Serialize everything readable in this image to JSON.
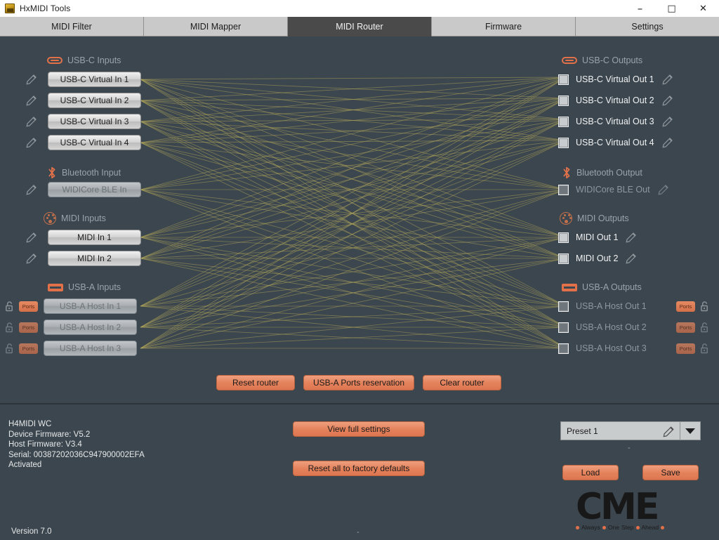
{
  "window": {
    "title": "HxMIDI Tools",
    "icon": "app-icon",
    "controls": {
      "minimize": "–",
      "maximize": "□",
      "close": "✕"
    }
  },
  "tabs": [
    {
      "label": "MIDI Filter",
      "active": false
    },
    {
      "label": "MIDI Mapper",
      "active": false
    },
    {
      "label": "MIDI Router",
      "active": true
    },
    {
      "label": "Firmware",
      "active": false
    },
    {
      "label": "Settings",
      "active": false
    }
  ],
  "router": {
    "input_sections": [
      {
        "title": "USB-C Inputs",
        "icon": "usb-c-icon",
        "ports": [
          {
            "label": "USB-C Virtual In 1",
            "muted": false,
            "edit": true
          },
          {
            "label": "USB-C Virtual In 2",
            "muted": false,
            "edit": true
          },
          {
            "label": "USB-C Virtual In 3",
            "muted": false,
            "edit": true
          },
          {
            "label": "USB-C Virtual In 4",
            "muted": false,
            "edit": true
          }
        ]
      },
      {
        "title": "Bluetooth Input",
        "icon": "bluetooth-icon",
        "ports": [
          {
            "label": "WIDICore BLE In",
            "muted": true,
            "edit": true
          }
        ]
      },
      {
        "title": "MIDI Inputs",
        "icon": "midi-din-icon",
        "ports": [
          {
            "label": "MIDI In 1",
            "muted": false,
            "edit": true
          },
          {
            "label": "MIDI In 2",
            "muted": false,
            "edit": true
          }
        ]
      },
      {
        "title": "USB-A Inputs",
        "icon": "usb-a-icon",
        "ports": [
          {
            "label": "USB-A Host In 1",
            "muted": true,
            "ports_label": "Ports",
            "lock": "unlocked"
          },
          {
            "label": "USB-A Host In 2",
            "muted": true,
            "ports_label": "Ports",
            "lock": "unlocked"
          },
          {
            "label": "USB-A Host In 3",
            "muted": true,
            "ports_label": "Ports",
            "lock": "unlocked"
          }
        ]
      }
    ],
    "output_sections": [
      {
        "title": "USB-C Outputs",
        "icon": "usb-c-icon",
        "ports": [
          {
            "label": "USB-C Virtual Out 1",
            "checked": false,
            "dim": false
          },
          {
            "label": "USB-C Virtual Out 2",
            "checked": false,
            "dim": false
          },
          {
            "label": "USB-C Virtual Out 3",
            "checked": false,
            "dim": false
          },
          {
            "label": "USB-C Virtual Out 4",
            "checked": false,
            "dim": false
          }
        ]
      },
      {
        "title": "Bluetooth Output",
        "icon": "bluetooth-icon",
        "ports": [
          {
            "label": "WIDICore BLE Out",
            "checked": false,
            "dim": true
          }
        ]
      },
      {
        "title": "MIDI Outputs",
        "icon": "midi-din-icon",
        "ports": [
          {
            "label": "MIDI Out 1",
            "checked": false,
            "dim": false
          },
          {
            "label": "MIDI Out 2",
            "checked": false,
            "dim": false
          }
        ]
      },
      {
        "title": "USB-A Outputs",
        "icon": "usb-a-icon",
        "ports": [
          {
            "label": "USB-A Host Out 1",
            "checked": false,
            "dim": true,
            "ports_label": "Ports",
            "lock": "unlocked"
          },
          {
            "label": "USB-A Host Out 2",
            "checked": false,
            "dim": true,
            "ports_label": "Ports",
            "lock": "unlocked"
          },
          {
            "label": "USB-A Host Out 3",
            "checked": false,
            "dim": true,
            "ports_label": "Ports",
            "lock": "unlocked"
          }
        ]
      }
    ],
    "actions": {
      "reset_router": "Reset router",
      "usb_a_reservation": "USB-A Ports reservation",
      "clear_router": "Clear router"
    }
  },
  "bottom": {
    "device": {
      "model": "H4MIDI WC",
      "device_firmware": "Device Firmware: V5.2",
      "host_firmware": "Host Firmware: V3.4",
      "serial": "Serial: 00387202036C947900002EFA",
      "status": "Activated"
    },
    "view_full_settings": "View full settings",
    "reset_factory": "Reset all to factory defaults",
    "preset": {
      "value": "Preset 1",
      "edit_icon": "pencil-icon",
      "dropdown_icon": "chevron-down-icon"
    },
    "load": "Load",
    "save": "Save",
    "separator_dot": "-",
    "preset_dot": "-",
    "version": "Version 7.0",
    "logo": {
      "word": "CME",
      "tagline": [
        "Always",
        "One",
        "Step",
        "Ahead"
      ]
    }
  },
  "colors": {
    "background": "#3c464e",
    "accent_orange": "#e2714a",
    "wire": "#b4a95a",
    "tab_active_bg": "#4a4a4a",
    "tab_bg": "#c9c9c9"
  }
}
